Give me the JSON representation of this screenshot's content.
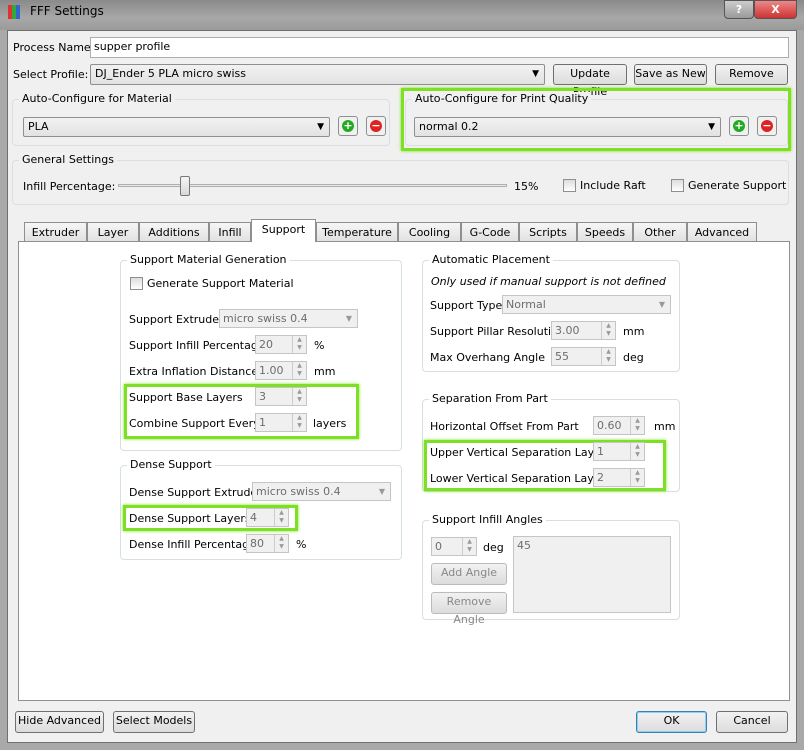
{
  "window": {
    "title": "FFF Settings",
    "help": "?",
    "close": "X"
  },
  "process_name": {
    "label": "Process Name:",
    "value": "supper profile"
  },
  "profile": {
    "label": "Select Profile:",
    "value": "DJ_Ender 5 PLA micro swiss",
    "update": "Update Profile",
    "save_new": "Save as New",
    "remove": "Remove"
  },
  "material": {
    "title": "Auto-Configure for Material",
    "value": "PLA"
  },
  "quality": {
    "title": "Auto-Configure for Print Quality",
    "value": "normal 0.2"
  },
  "general": {
    "title": "General Settings",
    "infill_label": "Infill Percentage:",
    "infill_value": "15%",
    "infill_fraction": 0.15,
    "raft": "Include Raft",
    "gen_support": "Generate Support"
  },
  "tabs": [
    "Extruder",
    "Layer",
    "Additions",
    "Infill",
    "Support",
    "Temperature",
    "Cooling",
    "G-Code",
    "Scripts",
    "Speeds",
    "Other",
    "Advanced"
  ],
  "active_tab": "Support",
  "smg": {
    "title": "Support Material Generation",
    "generate": "Generate Support Material",
    "extruder_label": "Support Extruder",
    "extruder": "micro swiss 0.4",
    "infill_label": "Support Infill Percentage",
    "infill": "20",
    "infill_unit": "%",
    "inflation_label": "Extra Inflation Distance",
    "inflation": "1.00",
    "inflation_unit": "mm",
    "base_label": "Support Base Layers",
    "base": "3",
    "combine_label": "Combine Support Every",
    "combine": "1",
    "combine_unit": "layers"
  },
  "dense": {
    "title": "Dense Support",
    "extruder_label": "Dense Support Extruder",
    "extruder": "micro swiss 0.4",
    "layers_label": "Dense Support Layers",
    "layers": "4",
    "infill_label": "Dense Infill Percentage",
    "infill": "80",
    "infill_unit": "%"
  },
  "auto": {
    "title": "Automatic Placement",
    "note": "Only used if manual support is not defined",
    "type_label": "Support Type",
    "type": "Normal",
    "pillar_label": "Support Pillar Resolution",
    "pillar": "3.00",
    "pillar_unit": "mm",
    "overhang_label": "Max Overhang Angle",
    "overhang": "55",
    "overhang_unit": "deg"
  },
  "sep": {
    "title": "Separation From Part",
    "h_label": "Horizontal Offset From Part",
    "h": "0.60",
    "h_unit": "mm",
    "upper_label": "Upper Vertical Separation Layers",
    "upper": "1",
    "lower_label": "Lower Vertical Separation Layers",
    "lower": "2"
  },
  "angles": {
    "title": "Support Infill Angles",
    "angle": "0",
    "unit": "deg",
    "add": "Add Angle",
    "remove": "Remove Angle",
    "list": "45"
  },
  "footer": {
    "hide_advanced": "Hide Advanced",
    "select_models": "Select Models",
    "ok": "OK",
    "cancel": "Cancel"
  }
}
